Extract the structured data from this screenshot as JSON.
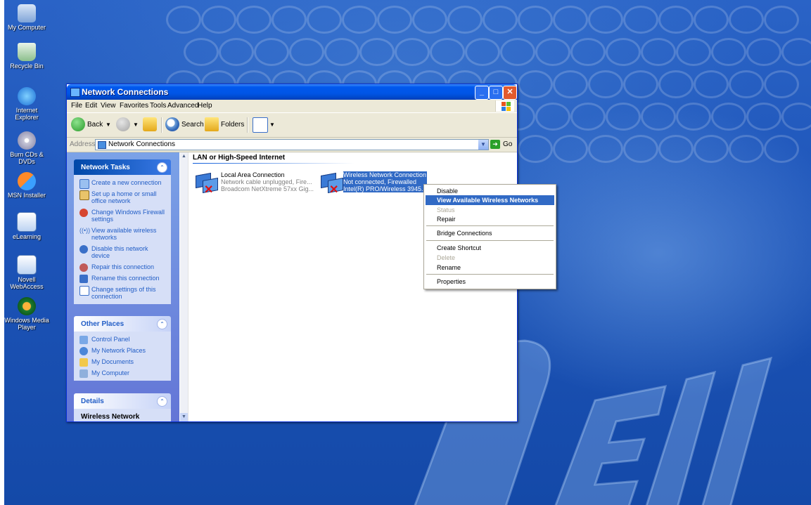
{
  "desktop": {
    "icons": [
      {
        "label": "My Computer"
      },
      {
        "label": "Recycle Bin"
      },
      {
        "label": "Internet Explorer"
      },
      {
        "label": "Burn CDs & DVDs"
      },
      {
        "label": "MSN Installer"
      },
      {
        "label": "eLearning"
      },
      {
        "label": "Novell WebAccess"
      },
      {
        "label": "Windows Media Player"
      }
    ]
  },
  "window": {
    "title": "Network Connections",
    "menu": [
      "File",
      "Edit",
      "View",
      "Favorites",
      "Tools",
      "Advanced",
      "Help"
    ],
    "toolbar": {
      "back": "Back",
      "search": "Search",
      "folders": "Folders"
    },
    "address": {
      "label": "Address",
      "value": "Network Connections",
      "go": "Go"
    }
  },
  "left_pane": {
    "network_tasks": {
      "title": "Network Tasks",
      "items": [
        "Create a new connection",
        "Set up a home or small office network",
        "Change Windows Firewall settings",
        "View available wireless networks",
        "Disable this network device",
        "Repair this connection",
        "Rename this connection",
        "Change settings of this connection"
      ]
    },
    "other_places": {
      "title": "Other Places",
      "items": [
        "Control Panel",
        "My Network Places",
        "My Documents",
        "My Computer"
      ]
    },
    "details": {
      "title": "Details",
      "subtitle": "Wireless Network"
    }
  },
  "content": {
    "group": "LAN or High-Speed Internet",
    "connections": [
      {
        "name": "Local Area Connection",
        "status": "Network cable unplugged, Fire...",
        "device": "Broadcom NetXtreme 57xx Gig..."
      },
      {
        "name": "Wireless Network Connection",
        "status": "Not connected, Firewalled",
        "device": "Intel(R) PRO/Wireless 3945..."
      }
    ]
  },
  "context_menu": {
    "disable": "Disable",
    "view_wireless": "View Available Wireless Networks",
    "status": "Status",
    "repair": "Repair",
    "bridge": "Bridge Connections",
    "shortcut": "Create Shortcut",
    "delete": "Delete",
    "rename": "Rename",
    "properties": "Properties"
  },
  "colors": {
    "selection": "#316ac5",
    "titlebar": "#0055e5",
    "desktop": "#1d54b8"
  }
}
